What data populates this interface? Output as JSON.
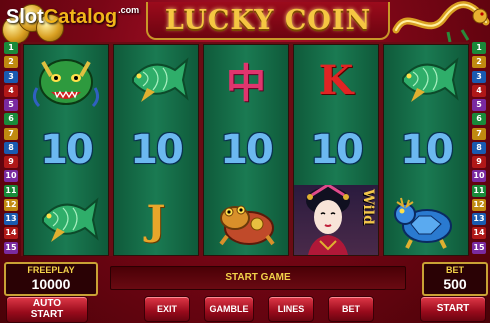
{
  "header": {
    "brand_slot": "Slot",
    "brand_catalog": "Catalog",
    "brand_com": ".com",
    "game_title": "LUCKY COIN"
  },
  "paylines_left": [
    "1",
    "2",
    "3",
    "4",
    "5",
    "6",
    "7",
    "8",
    "9",
    "10",
    "11",
    "12",
    "13",
    "14",
    "15"
  ],
  "paylines_right": [
    "1",
    "2",
    "3",
    "4",
    "5",
    "6",
    "7",
    "8",
    "9",
    "10",
    "11",
    "12",
    "13",
    "14",
    "15"
  ],
  "reels": [
    [
      "dragon-icon",
      "10",
      "carp-icon"
    ],
    [
      "carp-icon",
      "10",
      "glyph-j"
    ],
    [
      "glyph-o",
      "10",
      "frog-icon"
    ],
    [
      "glyph-k",
      "10",
      "wild-geisha"
    ],
    [
      "carp-icon",
      "10",
      "turtle-icon"
    ]
  ],
  "symbol_text": {
    "ten": "10",
    "glyph_o": "中",
    "glyph_k": "K",
    "glyph_j": "J",
    "wild": "Wild"
  },
  "panel": {
    "freeplay_label": "FREEPLAY",
    "freeplay_value": "10000",
    "message": "START GAME",
    "bet_label": "BET",
    "bet_value": "500"
  },
  "buttons": {
    "auto_start": "AUTO START",
    "exit": "EXIT",
    "gamble": "GAMBLE",
    "lines": "LINES",
    "bet": "BET",
    "start": "START"
  },
  "colors": {
    "accent_gold": "#f2c64a",
    "reel_green": "#1a7a52",
    "button_red": "#9a0b1c"
  }
}
